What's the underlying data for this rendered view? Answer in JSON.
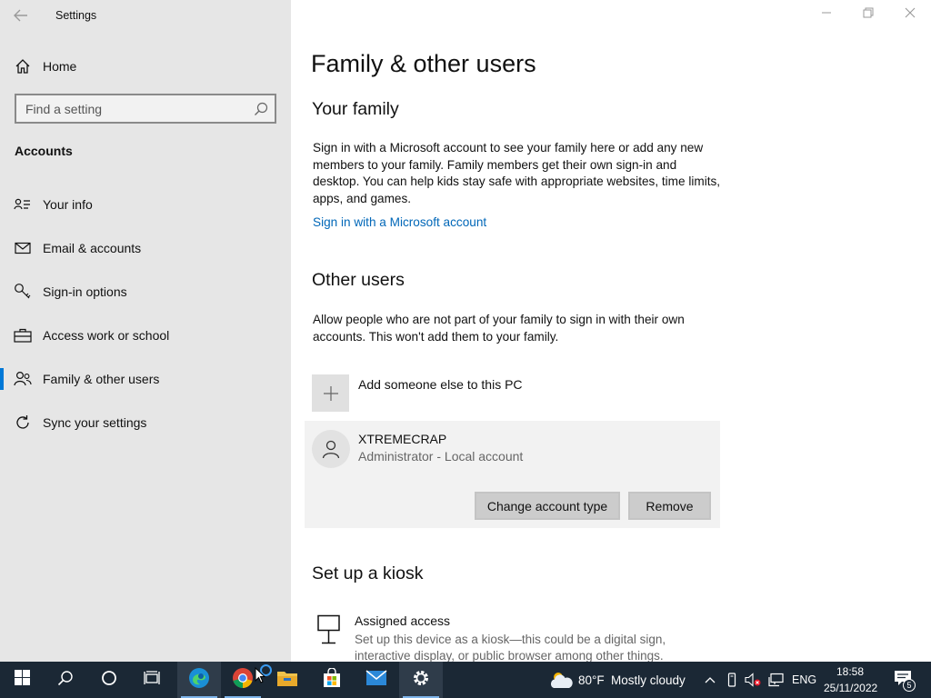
{
  "app": {
    "title": "Settings"
  },
  "sidebar": {
    "home_label": "Home",
    "search_placeholder": "Find a setting",
    "section": "Accounts",
    "items": [
      {
        "label": "Your info",
        "icon": "contact-card-icon"
      },
      {
        "label": "Email & accounts",
        "icon": "mail-icon"
      },
      {
        "label": "Sign-in options",
        "icon": "key-icon"
      },
      {
        "label": "Access work or school",
        "icon": "briefcase-icon"
      },
      {
        "label": "Family & other users",
        "icon": "people-icon",
        "selected": true
      },
      {
        "label": "Sync your settings",
        "icon": "sync-icon"
      }
    ]
  },
  "main": {
    "title": "Family & other users",
    "your_family": {
      "heading": "Your family",
      "description": "Sign in with a Microsoft account to see your family here or add any new members to your family. Family members get their own sign-in and desktop. You can help kids stay safe with appropriate websites, time limits, apps, and games.",
      "link": "Sign in with a Microsoft account"
    },
    "other_users": {
      "heading": "Other users",
      "description": "Allow people who are not part of your family to sign in with their own accounts. This won't add them to your family.",
      "add_label": "Add someone else to this PC",
      "user": {
        "name": "XTREMECRAP",
        "role": "Administrator - Local account",
        "change_button": "Change account type",
        "remove_button": "Remove"
      }
    },
    "kiosk": {
      "heading": "Set up a kiosk",
      "item_title": "Assigned access",
      "item_desc": "Set up this device as a kiosk—this could be a digital sign, interactive display, or public browser among other things."
    }
  },
  "taskbar": {
    "weather_temp": "80°F",
    "weather_desc": "Mostly cloudy",
    "language": "ENG",
    "time": "18:58",
    "date": "25/11/2022",
    "notification_count": "5",
    "colors": {
      "background": "#1b2835",
      "accent": "#0078d7"
    }
  }
}
